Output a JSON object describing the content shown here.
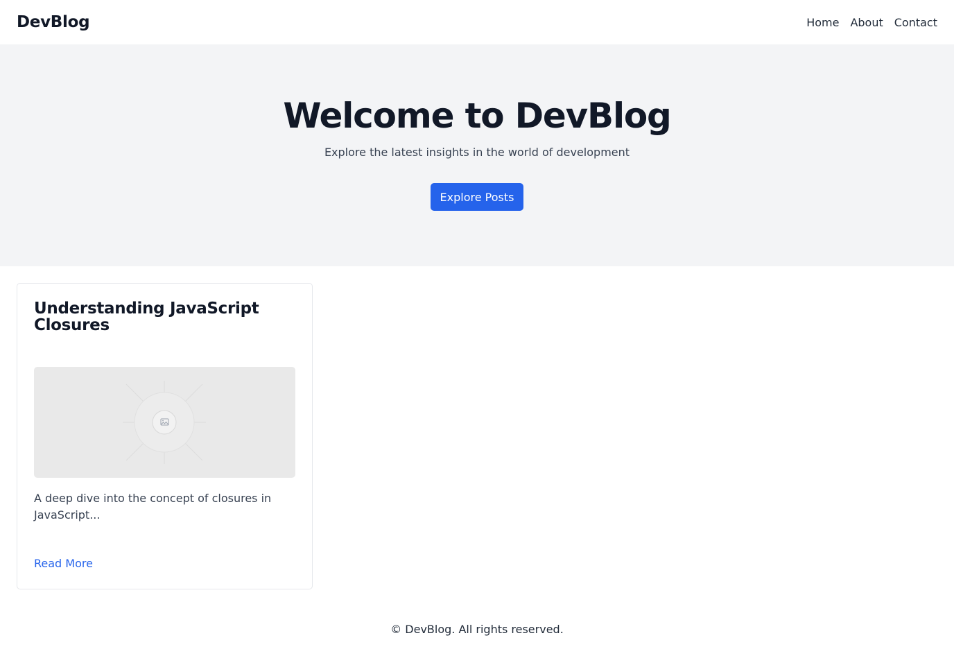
{
  "header": {
    "brand": "DevBlog",
    "nav": [
      {
        "label": "Home"
      },
      {
        "label": "About"
      },
      {
        "label": "Contact"
      }
    ]
  },
  "hero": {
    "title": "Welcome to DevBlog",
    "subtitle": "Explore the latest insights in the world of development",
    "button_label": "Explore Posts"
  },
  "posts": [
    {
      "title": "Understanding JavaScript Closures",
      "image_icon": "image-placeholder-icon",
      "excerpt": "A deep dive into the concept of closures in JavaScript...",
      "link_label": "Read More"
    }
  ],
  "footer": {
    "copyright": "© DevBlog. All rights reserved."
  },
  "colors": {
    "accent": "#2563eb",
    "hero_background": "#f3f4f6",
    "text_dark": "#111827",
    "text_muted": "#374151",
    "card_border": "#e5e7eb",
    "image_placeholder": "#e9e9e9"
  }
}
